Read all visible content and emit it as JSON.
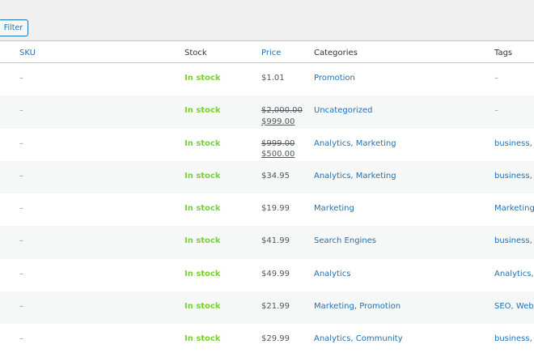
{
  "toolbar": {
    "filter_label": "Filter"
  },
  "columns": {
    "sku": "SKU",
    "stock": "Stock",
    "price": "Price",
    "categories": "Categories",
    "tags": "Tags"
  },
  "rows": [
    {
      "sku": "–",
      "stock": "In stock",
      "price": "$1.01",
      "old_price": "",
      "new_price": "",
      "categories": "Promotion",
      "tags": "–"
    },
    {
      "sku": "–",
      "stock": "In stock",
      "price": "",
      "old_price": "$2,000.00",
      "new_price": "$999.00",
      "categories": "Uncategorized",
      "tags": "–"
    },
    {
      "sku": "–",
      "stock": "In stock",
      "price": "",
      "old_price": "$999.00",
      "new_price": "$500.00",
      "categories": "Analytics, Marketing",
      "tags": "business, Co"
    },
    {
      "sku": "–",
      "stock": "In stock",
      "price": "$34.95",
      "old_price": "",
      "new_price": "",
      "categories": "Analytics, Marketing",
      "tags": "business, Co"
    },
    {
      "sku": "–",
      "stock": "In stock",
      "price": "$19.99",
      "old_price": "",
      "new_price": "",
      "categories": "Marketing",
      "tags": "Marketing, W"
    },
    {
      "sku": "–",
      "stock": "In stock",
      "price": "$41.99",
      "old_price": "",
      "new_price": "",
      "categories": "Search Engines",
      "tags": "business, Pr"
    },
    {
      "sku": "–",
      "stock": "In stock",
      "price": "$49.99",
      "old_price": "",
      "new_price": "",
      "categories": "Analytics",
      "tags": "Analytics, W"
    },
    {
      "sku": "–",
      "stock": "In stock",
      "price": "$21.99",
      "old_price": "",
      "new_price": "",
      "categories": "Marketing, Promotion",
      "tags": "SEO, Web"
    },
    {
      "sku": "–",
      "stock": "In stock",
      "price": "$29.99",
      "old_price": "",
      "new_price": "",
      "categories": "Analytics, Community",
      "tags": "business, M"
    }
  ],
  "colors": {
    "link": "#2271b1",
    "in_stock": "#7ad03a",
    "muted": "#8c8f94"
  }
}
